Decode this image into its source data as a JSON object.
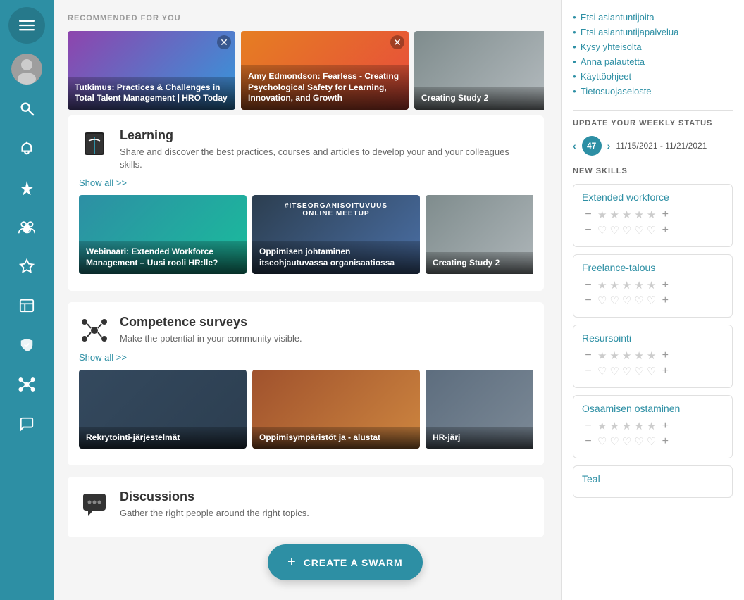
{
  "sidebar": {
    "items": [
      {
        "id": "menu",
        "icon": "≡",
        "label": "Menu"
      },
      {
        "id": "avatar",
        "icon": "👤",
        "label": "Profile"
      },
      {
        "id": "search",
        "icon": "🔍",
        "label": "Search"
      },
      {
        "id": "notifications",
        "icon": "🔔",
        "label": "Notifications"
      },
      {
        "id": "favorites",
        "icon": "★",
        "label": "Favorites"
      },
      {
        "id": "community",
        "icon": "👥",
        "label": "Community"
      },
      {
        "id": "achievements",
        "icon": "⭐",
        "label": "Achievements"
      },
      {
        "id": "cube",
        "icon": "⬡",
        "label": "Content"
      },
      {
        "id": "book",
        "icon": "📚",
        "label": "Learning"
      },
      {
        "id": "people-dots",
        "icon": "❊",
        "label": "Network"
      },
      {
        "id": "chat",
        "icon": "💬",
        "label": "Chat"
      }
    ]
  },
  "main": {
    "recommended_label": "RECOMMENDED FOR YOU",
    "recommended_cards": [
      {
        "title": "Tutkimus: Practices & Challenges in Total Talent Management | HRO Today",
        "bg": "card1-bg"
      },
      {
        "title": "Amy Edmondson: Fearless - Creating Psychological Safety for Learning, Innovation, and Growth",
        "bg": "card2-bg"
      },
      {
        "title": "Creating Study 2",
        "bg": "card3-bg"
      }
    ],
    "learning": {
      "title": "Learning",
      "description": "Share and discover the best practices, courses and articles to develop your and your colleagues skills.",
      "show_all": "Show all >>",
      "cards": [
        {
          "title": "Webinaari: Extended Workforce Management – Uusi rooli HR:lle?",
          "bg": "card4-bg"
        },
        {
          "title": "#ITSEORGANISOITUVUUS ONLINE MEETUP\nOppimisen johtaminen itseohjautuvassa organisaatiossa",
          "bg": "card5-bg"
        },
        {
          "title": "Creating Study 2",
          "bg": "card6-bg"
        }
      ]
    },
    "competence": {
      "title": "Competence surveys",
      "description": "Make the potential in your community visible.",
      "show_all": "Show all >>",
      "cards": [
        {
          "title": "Rekrytointi-järjestelmät",
          "bg": "card7-bg"
        },
        {
          "title": "Oppimisympäristöt ja - alustat",
          "bg": "card8-bg"
        },
        {
          "title": "HR-järj",
          "bg": "card9-bg"
        }
      ]
    },
    "discussions": {
      "title": "Discussions",
      "description": "Gather the right people around the right topics.",
      "create_swarm": "CREATE A SWARM"
    }
  },
  "right_panel": {
    "menu_links": [
      "Etsi asiantuntijoita",
      "Etsi asiantuntijapalvelua",
      "Kysy yhteisöltä",
      "Anna palautetta",
      "Käyttöohjeet",
      "Tietosuojaseloste"
    ],
    "weekly_status": {
      "label": "UPDATE YOUR WEEKLY STATUS",
      "week_number": "47",
      "date_range": "11/15/2021 - 11/21/2021"
    },
    "new_skills_label": "NEW SKILLS",
    "skills": [
      {
        "name": "Extended workforce"
      },
      {
        "name": "Freelance-talous"
      },
      {
        "name": "Resursointi"
      },
      {
        "name": "Osaamisen ostaminen"
      },
      {
        "name": "Teal"
      }
    ]
  }
}
